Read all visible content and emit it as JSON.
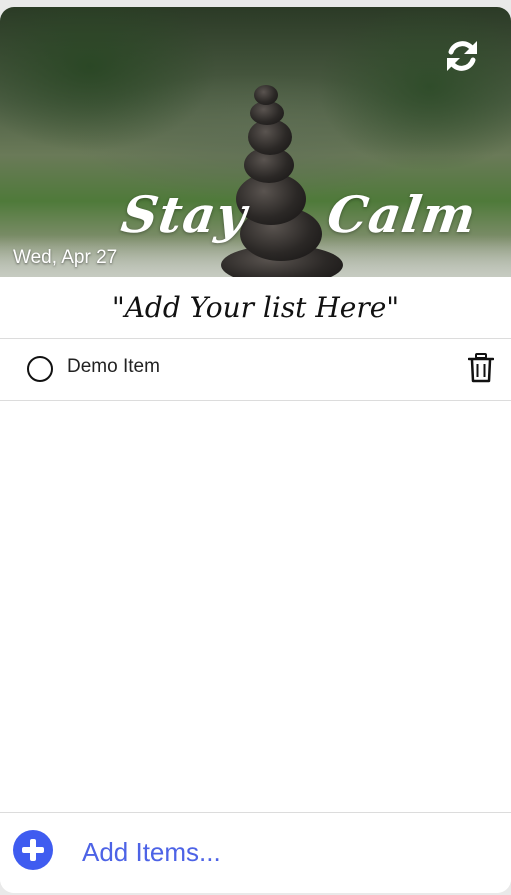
{
  "header": {
    "quote_left": "Stay",
    "quote_right": "Calm",
    "date": "Wed, Apr 27",
    "refresh_icon": "refresh-icon"
  },
  "list": {
    "title": "\"Add Your list Here\"",
    "items": [
      {
        "label": "Demo Item",
        "done": false
      }
    ]
  },
  "footer": {
    "add_placeholder": "Add Items...",
    "add_icon": "plus-circle-icon"
  },
  "colors": {
    "accent": "#3f5cf0",
    "text": "#111111",
    "divider": "#dcdcdc"
  }
}
